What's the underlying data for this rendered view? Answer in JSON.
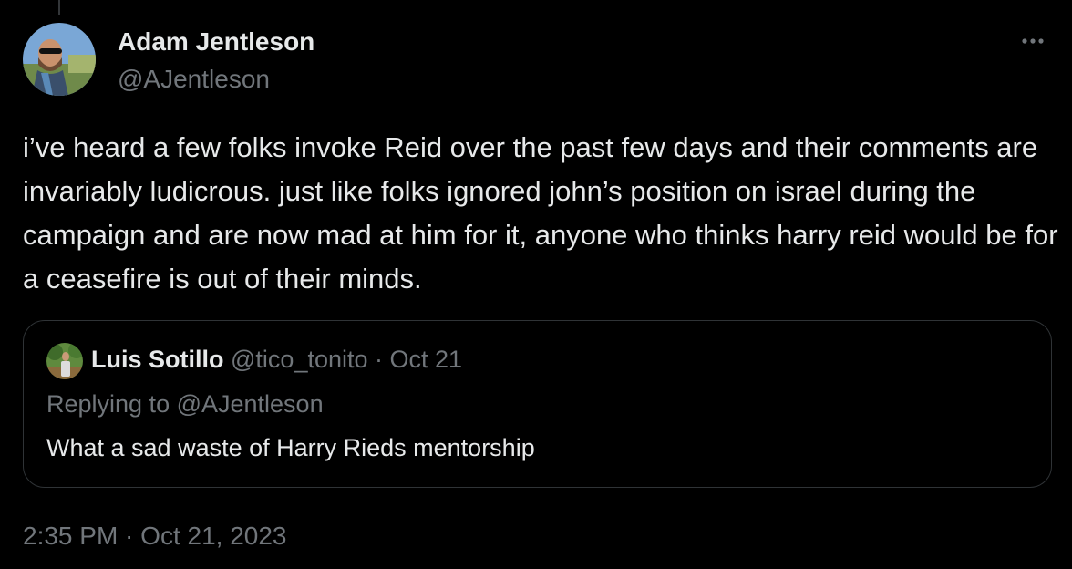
{
  "tweet": {
    "author": {
      "name": "Adam Jentleson",
      "handle": "@AJentleson"
    },
    "more_icon": "more-horizontal-icon",
    "text": "i’ve heard a few folks invoke Reid over the past few days and their comments are invariably ludicrous. just like folks ignored john’s position on israel during the campaign and are now mad at him for it, anyone who thinks harry reid would be for a ceasefire is out of their minds.",
    "timestamp": "2:35 PM · Oct 21, 2023"
  },
  "quote": {
    "author": {
      "name": "Luis Sotillo",
      "handle": "@tico_tonito",
      "date": "Oct 21"
    },
    "separator": " · ",
    "replying_to": "Replying to @AJentleson",
    "text": "What a sad waste of Harry Rieds mentorship"
  },
  "colors": {
    "background": "#000000",
    "primary_text": "#e7e9ea",
    "secondary_text": "#71767b",
    "border": "#2f3336"
  }
}
